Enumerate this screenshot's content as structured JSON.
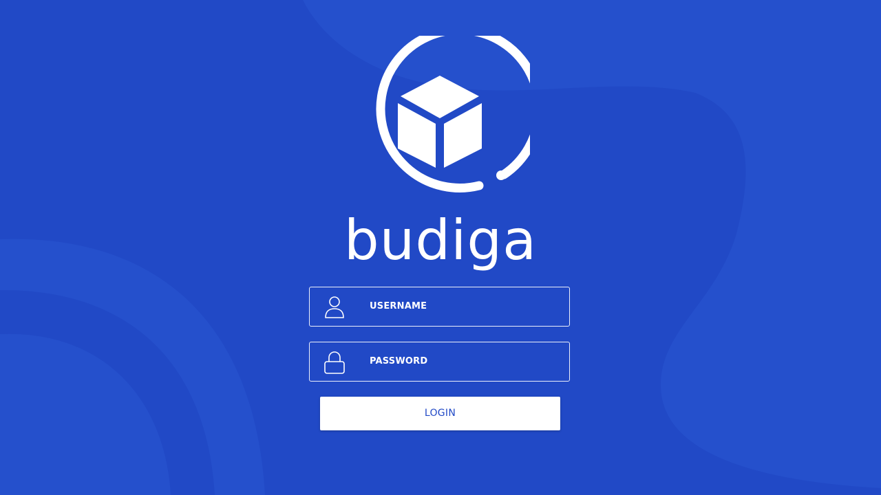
{
  "app": {
    "brand_name": "budiga",
    "logo_icon": "cube-in-ring-logo-icon"
  },
  "colors": {
    "background": "#2149c6",
    "background_shape": "#2550cc",
    "foreground": "#ffffff",
    "button_text": "#2149c6"
  },
  "login_form": {
    "username": {
      "placeholder": "USERNAME",
      "icon": "user-icon"
    },
    "password": {
      "placeholder": "PASSWORD",
      "icon": "lock-icon"
    },
    "submit_label": "LOGIN"
  }
}
